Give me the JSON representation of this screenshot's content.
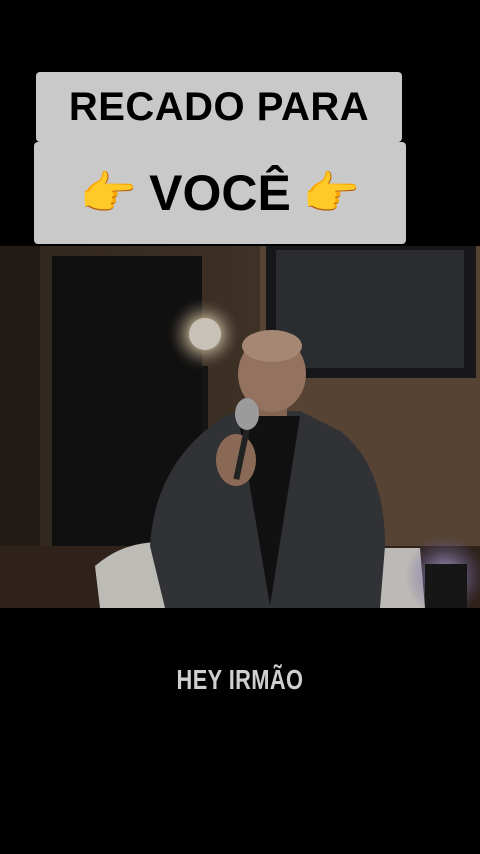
{
  "title": {
    "line1": "RECADO PARA",
    "line2": "VOCÊ",
    "icon_left": "pointing-hand-icon",
    "icon_right": "pointing-hand-icon",
    "emoji": "👉"
  },
  "video": {
    "description_icon": "video-frame"
  },
  "caption": {
    "text": "HEY IRMÃO"
  },
  "colors": {
    "background": "#000000",
    "title_box": "#c9c9c9",
    "caption_text": "#cfcfcf"
  }
}
